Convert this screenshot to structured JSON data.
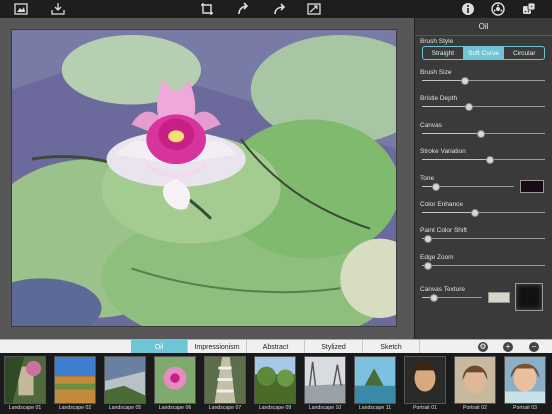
{
  "toolbar": {
    "left_icons": [
      "image-library-icon",
      "save-tray-icon"
    ],
    "center_icons": [
      "crop-icon",
      "undo-icon",
      "redo-icon",
      "compare-icon"
    ],
    "right_icons": [
      "info-icon",
      "settings-icon",
      "randomize-dice-icon"
    ]
  },
  "panel": {
    "title": "Oil",
    "brush_style": {
      "label": "Brush Style",
      "options": [
        "Straight",
        "Soft Curve",
        "Circular"
      ],
      "selected": "Soft Curve"
    },
    "sliders": [
      {
        "label": "Brush Size",
        "value": 0.35
      },
      {
        "label": "Bristle Depth",
        "value": 0.38
      },
      {
        "label": "Canvas",
        "value": 0.48
      },
      {
        "label": "Stroke Variation",
        "value": 0.55
      },
      {
        "label": "Tone",
        "value": 0.15
      },
      {
        "label": "Color Enhance",
        "value": 0.43
      },
      {
        "label": "Paint Color Shift",
        "value": 0.05
      },
      {
        "label": "Edge Zoom",
        "value": 0.05
      },
      {
        "label": "Canvas Texture",
        "value": 0.2
      }
    ],
    "tone_color": "#1a0a18",
    "canvas_texture_color": "#d4d8c8"
  },
  "style_tabs": {
    "items": [
      "Oil",
      "Impressionism",
      "Abstract",
      "Stylized",
      "Sketch"
    ],
    "active": "Oil",
    "buttons": [
      "gallery-settings-icon",
      "add-icon",
      "remove-icon"
    ]
  },
  "presets": [
    {
      "label": "Landscape 01"
    },
    {
      "label": "Landscape 02"
    },
    {
      "label": "Landscape 05"
    },
    {
      "label": "Landscape 06"
    },
    {
      "label": "Landscape 07"
    },
    {
      "label": "Landscape 09"
    },
    {
      "label": "Landscape 10"
    },
    {
      "label": "Landscape 11"
    },
    {
      "label": "Portrait 01"
    },
    {
      "label": "Portrait 02"
    },
    {
      "label": "Portrait 03"
    }
  ],
  "colors": {
    "accent": "#6fc4d6"
  }
}
